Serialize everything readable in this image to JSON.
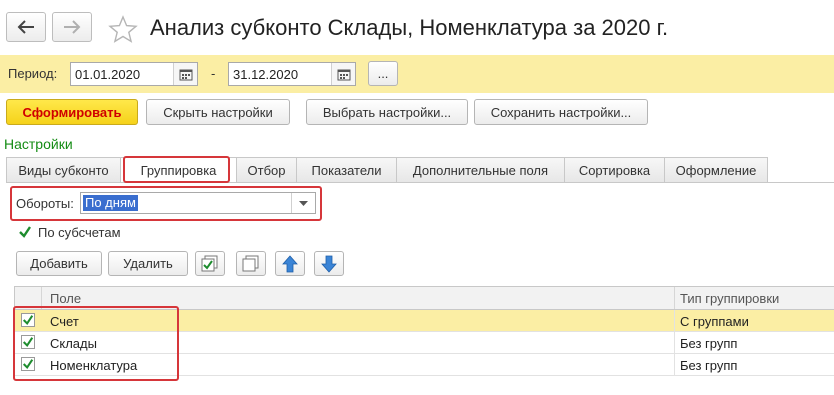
{
  "window": {
    "title": "Анализ субконто Склады, Номенклатура  за 2020 г."
  },
  "period": {
    "label": "Период:",
    "from": "01.01.2020",
    "dash": "-",
    "to": "31.12.2020",
    "more_label": "..."
  },
  "toolbar": {
    "generate_label": "Сформировать",
    "hide_settings_label": "Скрыть настройки",
    "choose_settings_label": "Выбрать настройки...",
    "save_settings_label": "Сохранить настройки..."
  },
  "settings": {
    "title": "Настройки",
    "tabs": [
      {
        "label": "Виды субконто"
      },
      {
        "label": "Группировка"
      },
      {
        "label": "Отбор"
      },
      {
        "label": "Показатели"
      },
      {
        "label": "Дополнительные поля"
      },
      {
        "label": "Сортировка"
      },
      {
        "label": "Оформление"
      }
    ],
    "active_tab": "Группировка"
  },
  "grouping": {
    "turnover_label": "Обороты:",
    "turnover_value": "По дням",
    "by_subaccounts_label": "По субсчетам",
    "by_subaccounts_checked": true,
    "add_label": "Добавить",
    "delete_label": "Удалить",
    "icons": [
      "check-all-icon",
      "uncheck-all-icon",
      "move-up-icon",
      "move-down-icon"
    ]
  },
  "table": {
    "columns": [
      "Поле",
      "Тип группировки"
    ],
    "rows": [
      {
        "checked": true,
        "field": "Счет",
        "type": "С группами",
        "selected": true
      },
      {
        "checked": true,
        "field": "Склады",
        "type": "Без групп",
        "selected": false
      },
      {
        "checked": true,
        "field": "Номенклатура",
        "type": "Без групп",
        "selected": false
      }
    ]
  },
  "colors": {
    "accent_yellow": "#fbeea4",
    "primary_text": "#d00000",
    "settings_green": "#148c14",
    "highlight_red": "#d6363a",
    "selection_blue": "#3a6ecf"
  }
}
